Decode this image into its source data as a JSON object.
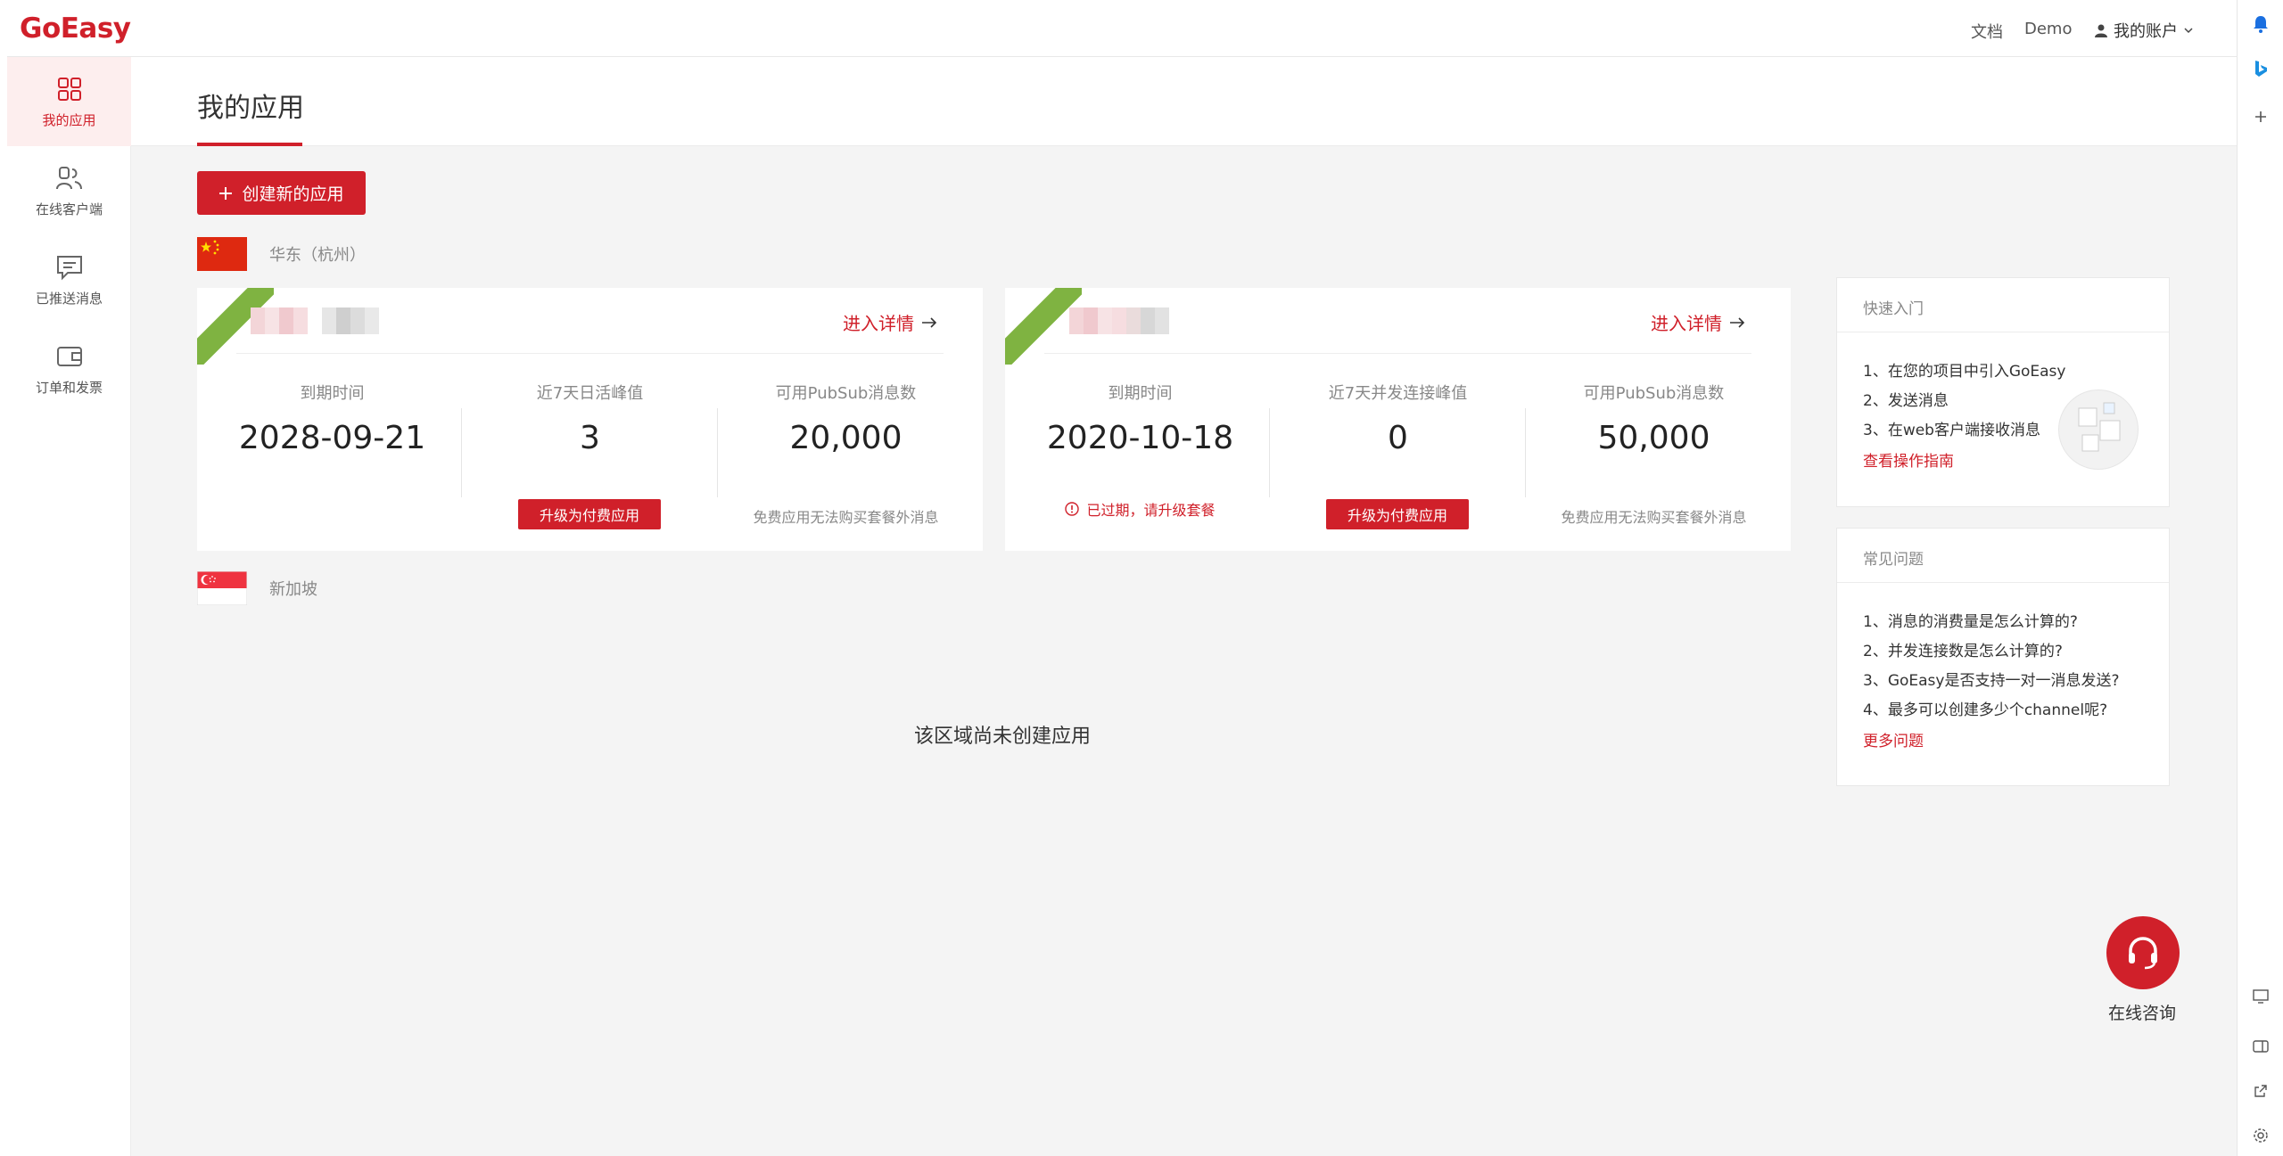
{
  "header": {
    "logo": "GoEasy",
    "docs_label": "文档",
    "demo_label": "Demo",
    "account_label": "我的账户"
  },
  "sidebar": {
    "items": [
      {
        "label": "我的应用",
        "icon": "grid-icon",
        "active": true
      },
      {
        "label": "在线客户端",
        "icon": "users-icon",
        "active": false
      },
      {
        "label": "已推送消息",
        "icon": "message-icon",
        "active": false
      },
      {
        "label": "订单和发票",
        "icon": "wallet-icon",
        "active": false
      }
    ]
  },
  "main": {
    "title": "我的应用",
    "create_button_label": "创建新的应用",
    "regions": [
      {
        "name": "华东（杭州）",
        "flag": "china-flag"
      },
      {
        "name": "新加坡",
        "flag": "singapore-flag"
      }
    ],
    "apps": [
      {
        "detail_label": "进入详情",
        "stats": [
          {
            "label": "到期时间",
            "value": "2028-09-21"
          },
          {
            "label": "近7天日活峰值",
            "value": "3"
          },
          {
            "label": "可用PubSub消息数",
            "value": "20,000"
          }
        ],
        "expired_text": "",
        "upgrade_label": "升级为付费应用",
        "note": "免费应用无法购买套餐外消息"
      },
      {
        "detail_label": "进入详情",
        "stats": [
          {
            "label": "到期时间",
            "value": "2020-10-18"
          },
          {
            "label": "近7天并发连接峰值",
            "value": "0"
          },
          {
            "label": "可用PubSub消息数",
            "value": "50,000"
          }
        ],
        "expired_text": "已过期，请升级套餐",
        "upgrade_label": "升级为付费应用",
        "note": "免费应用无法购买套餐外消息"
      }
    ],
    "empty_region_text": "该区域尚未创建应用"
  },
  "quick_start": {
    "title": "快速入门",
    "items": [
      "1、在您的项目中引入GoEasy",
      "2、发送消息",
      "3、在web客户端接收消息"
    ],
    "link": "查看操作指南"
  },
  "faq": {
    "title": "常见问题",
    "items": [
      "1、消息的消费量是怎么计算的?",
      "2、并发连接数是怎么计算的?",
      "3、GoEasy是否支持一对一消息发送?",
      "4、最多可以创建多少个channel呢?"
    ],
    "link": "更多问题"
  },
  "consult": {
    "label": "在线咨询",
    "icon": "headset-icon"
  },
  "colors": {
    "brand": "#d0202a",
    "ribbon": "#7fb341",
    "background": "#f4f4f4"
  }
}
